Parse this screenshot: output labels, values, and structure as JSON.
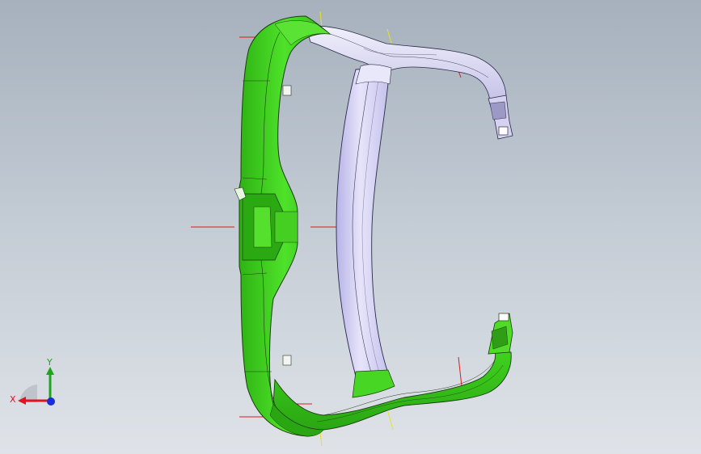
{
  "viewport": {
    "name": "3d-model-viewport",
    "model": "frame-part"
  },
  "triad": {
    "x_label": "X",
    "y_label": "Y",
    "x_color": "#e0141e",
    "y_color": "#1ea51e",
    "z_color": "#1a2bd9"
  },
  "colors": {
    "selected_face": "#3ad11e",
    "unselected_face": "#d9d6f2",
    "reference_line": "#d81c1c",
    "axis_line": "#e6e31e",
    "edge": "#1d3a12"
  }
}
